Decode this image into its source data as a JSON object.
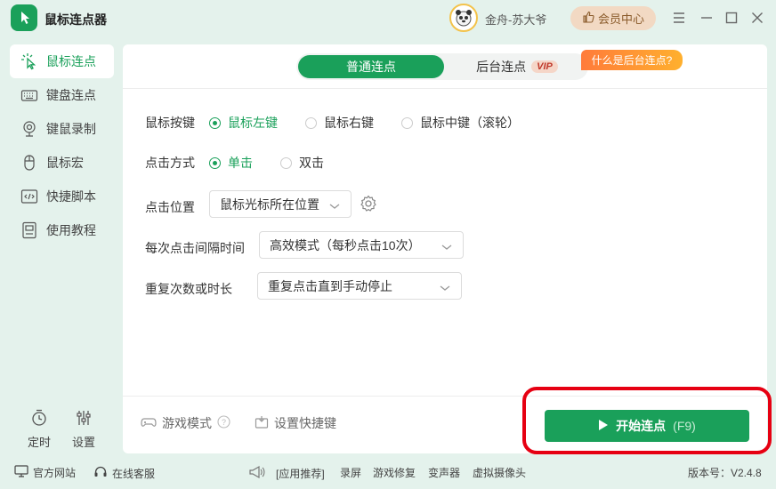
{
  "app": {
    "title": "鼠标连点器"
  },
  "user": {
    "name": "金舟-苏大爷",
    "member_label": "会员中心"
  },
  "sidebar": {
    "items": [
      {
        "label": "鼠标连点",
        "icon": "mouse-click-icon"
      },
      {
        "label": "键盘连点",
        "icon": "keyboard-icon"
      },
      {
        "label": "键鼠录制",
        "icon": "webcam-record-icon"
      },
      {
        "label": "鼠标宏",
        "icon": "mouse-icon"
      },
      {
        "label": "快捷脚本",
        "icon": "code-script-icon"
      },
      {
        "label": "使用教程",
        "icon": "tutorial-doc-icon"
      }
    ],
    "active_index": 0,
    "timer_label": "定时",
    "settings_label": "设置"
  },
  "tabs": {
    "normal_label": "普通连点",
    "background_label": "后台连点",
    "vip_badge": "VIP",
    "tooltip": "什么是后台连点?"
  },
  "form": {
    "mouse_button": {
      "label": "鼠标按键",
      "options": [
        "鼠标左键",
        "鼠标右键",
        "鼠标中键（滚轮）"
      ],
      "selected": 0
    },
    "click_type": {
      "label": "点击方式",
      "options": [
        "单击",
        "双击"
      ],
      "selected": 0
    },
    "click_position": {
      "label": "点击位置",
      "value": "鼠标光标所在位置"
    },
    "interval": {
      "label": "每次点击间隔时间",
      "value": "高效模式（每秒点击10次）"
    },
    "repeat": {
      "label": "重复次数或时长",
      "value": "重复点击直到手动停止"
    }
  },
  "footer": {
    "game_mode_label": "游戏模式",
    "hotkey_label": "设置快捷键",
    "start_label": "开始连点",
    "start_hotkey": "(F9)"
  },
  "statusbar": {
    "website": "官方网站",
    "support": "在线客服",
    "recommend": "[应用推荐]",
    "links": [
      "录屏",
      "游戏修复",
      "变声器",
      "虚拟摄像头"
    ],
    "version": "版本号：V2.4.8"
  },
  "colors": {
    "accent": "#1aa05a",
    "highlight_ring": "#e60012",
    "background": "#e4f2ec"
  }
}
